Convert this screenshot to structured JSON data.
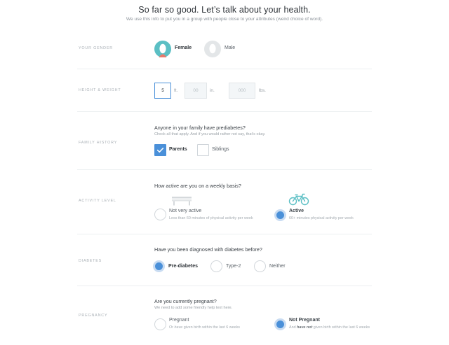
{
  "header": {
    "title": "So far so good. Let’s talk about your health.",
    "subtitle": "We use this info to put you in a group with people close to your attributes (weird choice of word)."
  },
  "gender": {
    "label": "YOUR GENDER",
    "options": [
      {
        "label": "Female",
        "selected": true
      },
      {
        "label": "Male",
        "selected": false
      }
    ]
  },
  "height_weight": {
    "label": "HEIGHT & WEIGHT",
    "feet": {
      "value": "5",
      "unit": "ft."
    },
    "inches": {
      "placeholder": "00",
      "unit": "in."
    },
    "pounds": {
      "placeholder": "000",
      "unit": "lbs."
    }
  },
  "family_history": {
    "label": "FAMILY HISTORY",
    "question": "Anyone in your family have prediabetes?",
    "hint": "Check all that apply. And if you would rather not say, that’s okay.",
    "options": [
      {
        "label": "Parents",
        "checked": true
      },
      {
        "label": "Siblings",
        "checked": false
      }
    ]
  },
  "activity": {
    "label": "ACTIVITY LEVEL",
    "question": "How active are you on a weekly basis?",
    "options": [
      {
        "label": "Not very active",
        "sub": "Less than 60 minutes of physical activity per week",
        "selected": false,
        "icon": "bench-icon"
      },
      {
        "label": "Active",
        "sub": "60+ minutes physical activity per week",
        "selected": true,
        "icon": "bicycle-icon"
      }
    ]
  },
  "diabetes": {
    "label": "DIABETES",
    "question": "Have you been diagnosed with diabetes before?",
    "options": [
      {
        "label": "Pre-diabetes",
        "selected": true
      },
      {
        "label": "Type-2",
        "selected": false
      },
      {
        "label": "Neither",
        "selected": false
      }
    ]
  },
  "pregnancy": {
    "label": "PREGNANCY",
    "question": "Are you currently pregnant?",
    "hint": "We need to add some friendly help text here.",
    "options": [
      {
        "label": "Pregnant",
        "sub_pre": "Or ",
        "sub_em": "have",
        "sub_post": " given birth within the last 6 weeks",
        "selected": false
      },
      {
        "label": "Not Pregnant",
        "sub_pre": "And ",
        "sub_em": "have not",
        "sub_post": " given birth within the last 6 weeks",
        "selected": true
      }
    ]
  },
  "colors": {
    "accent": "#4a90d9",
    "female_avatar": "#5bbfc4",
    "male_avatar": "#e3e6e8"
  }
}
